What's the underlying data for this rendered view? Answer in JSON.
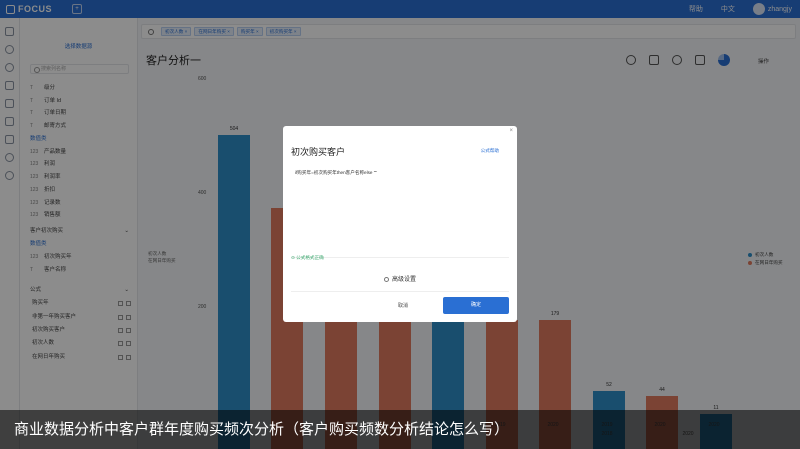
{
  "topbar": {
    "logo": "FOCUS",
    "add_tab": "+",
    "links": [
      "帮助",
      "中文"
    ],
    "user": "zhangjy"
  },
  "sidebar": {
    "datasource_button": "选择数据源",
    "search_placeholder": "搜索列名称",
    "dimensions": [
      {
        "type": "T",
        "label": "级分"
      },
      {
        "type": "T",
        "label": "订单 Id"
      },
      {
        "type": "T",
        "label": "订单日期"
      },
      {
        "type": "T",
        "label": "邮寄方式"
      }
    ],
    "measure_group": "数值类",
    "measures": [
      {
        "type": "123",
        "label": "产品数量"
      },
      {
        "type": "123",
        "label": "利润"
      },
      {
        "type": "123",
        "label": "利润率"
      },
      {
        "type": "123",
        "label": "折扣"
      },
      {
        "type": "123",
        "label": "记录数"
      },
      {
        "type": "123",
        "label": "销售额"
      }
    ],
    "group2_title": "客户初次购买",
    "group2_sub": "数值类",
    "group2_items": [
      {
        "type": "123",
        "label": "初次购买年"
      },
      {
        "type": "T",
        "label": "客户名称"
      }
    ],
    "formula_title": "公式",
    "formulas": [
      "购买年",
      "非第一年购买客户",
      "初次购买客户",
      "初次人数",
      "在网日年购买"
    ]
  },
  "filters": [
    "初次人数",
    "在网日年购买",
    "购买年",
    "初次购买年"
  ],
  "page": {
    "title": "客户分析一",
    "ops": "操作"
  },
  "chart_data": {
    "type": "bar",
    "yticks": [
      "600",
      "400",
      "200"
    ],
    "ylegend": [
      "初次人数",
      "在网日年购买"
    ],
    "series": [
      {
        "name": "初次人数",
        "color": "#2e8fc8"
      },
      {
        "name": "在网日年购买",
        "color": "#e07a5f"
      }
    ],
    "bar_labels": [
      "504",
      "179",
      "52",
      "44",
      "11"
    ],
    "x_labels": [
      "2019",
      "2020",
      "2019",
      "2020",
      "2020",
      "2018",
      "2020"
    ]
  },
  "modal": {
    "title": "初次购买客户",
    "formula_help": "公式帮助",
    "formula_text": "if购买年=初次购买年then客户名称else  \"\"",
    "valid": "公式格式正确",
    "advanced": "高级设置",
    "cancel": "取消",
    "ok": "确定",
    "close": "×"
  },
  "caption": "商业数据分析中客户群年度购买频次分析（客户购买频数分析结论怎么写）"
}
